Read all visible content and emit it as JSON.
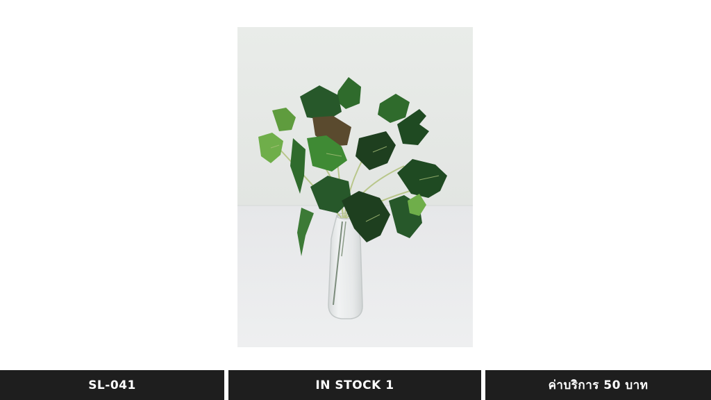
{
  "product": {
    "image_subject": "artificial ivy plant in clear glass vase",
    "colors": {
      "leaf_dark": "#1f4a22",
      "leaf_mid": "#2f6b2c",
      "leaf_light": "#6fae4a",
      "bar_background": "#1e1e1e",
      "bar_text": "#ffffff"
    }
  },
  "footer": {
    "code": "SL-041",
    "stock": "IN STOCK 1",
    "price": "ค่าบริการ 50 บาท"
  }
}
